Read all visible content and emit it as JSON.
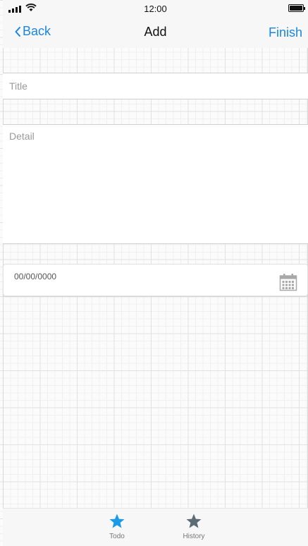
{
  "status_bar": {
    "time": "12:00"
  },
  "nav": {
    "back_label": "Back",
    "title": "Add",
    "finish_label": "Finish",
    "accent_color": "#1a86e0"
  },
  "form": {
    "title_placeholder": "Title",
    "detail_placeholder": "Detail",
    "date_value": "00/00/0000",
    "calendar_icon": "calendar-icon"
  },
  "tabs": [
    {
      "label": "Todo",
      "icon": "star-icon",
      "active": true,
      "color": "#1a9be8"
    },
    {
      "label": "History",
      "icon": "star-icon",
      "active": false,
      "color": "#5d6b75"
    }
  ]
}
